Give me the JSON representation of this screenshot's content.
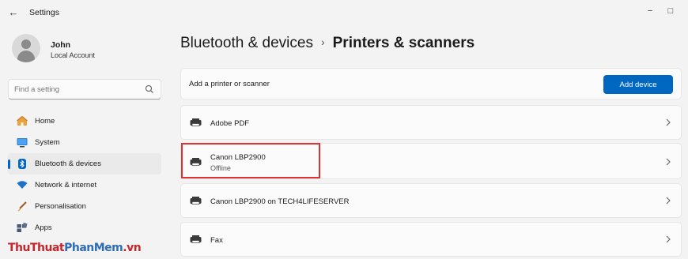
{
  "window": {
    "title": "Settings",
    "back_glyph": "←",
    "minimize_glyph": "−",
    "maximize_glyph": "□",
    "close_glyph": "›"
  },
  "profile": {
    "name": "John",
    "account_type": "Local Account"
  },
  "search": {
    "placeholder": "Find a setting"
  },
  "nav": {
    "items": [
      {
        "label": "Home",
        "icon": "home-icon"
      },
      {
        "label": "System",
        "icon": "system-icon"
      },
      {
        "label": "Bluetooth & devices",
        "icon": "bluetooth-icon",
        "active": true
      },
      {
        "label": "Network & internet",
        "icon": "wifi-icon"
      },
      {
        "label": "Personalisation",
        "icon": "brush-icon"
      },
      {
        "label": "Apps",
        "icon": "apps-icon"
      }
    ]
  },
  "breadcrumb": {
    "parent": "Bluetooth & devices",
    "separator": "›",
    "current": "Printers & scanners"
  },
  "add_printer": {
    "label": "Add a printer or scanner",
    "button": "Add device"
  },
  "printers": [
    {
      "name": "Adobe PDF",
      "status": ""
    },
    {
      "name": "Canon LBP2900",
      "status": "Offline"
    },
    {
      "name": "Canon LBP2900 on TECH4LIFESERVER",
      "status": ""
    },
    {
      "name": "Fax",
      "status": ""
    }
  ],
  "watermark": {
    "part1": "ThuThuat",
    "part2": "PhanMem",
    "part3": ".vn"
  },
  "colors": {
    "accent": "#0067c0",
    "highlight": "#e03232",
    "background": "#f3f3f3"
  }
}
